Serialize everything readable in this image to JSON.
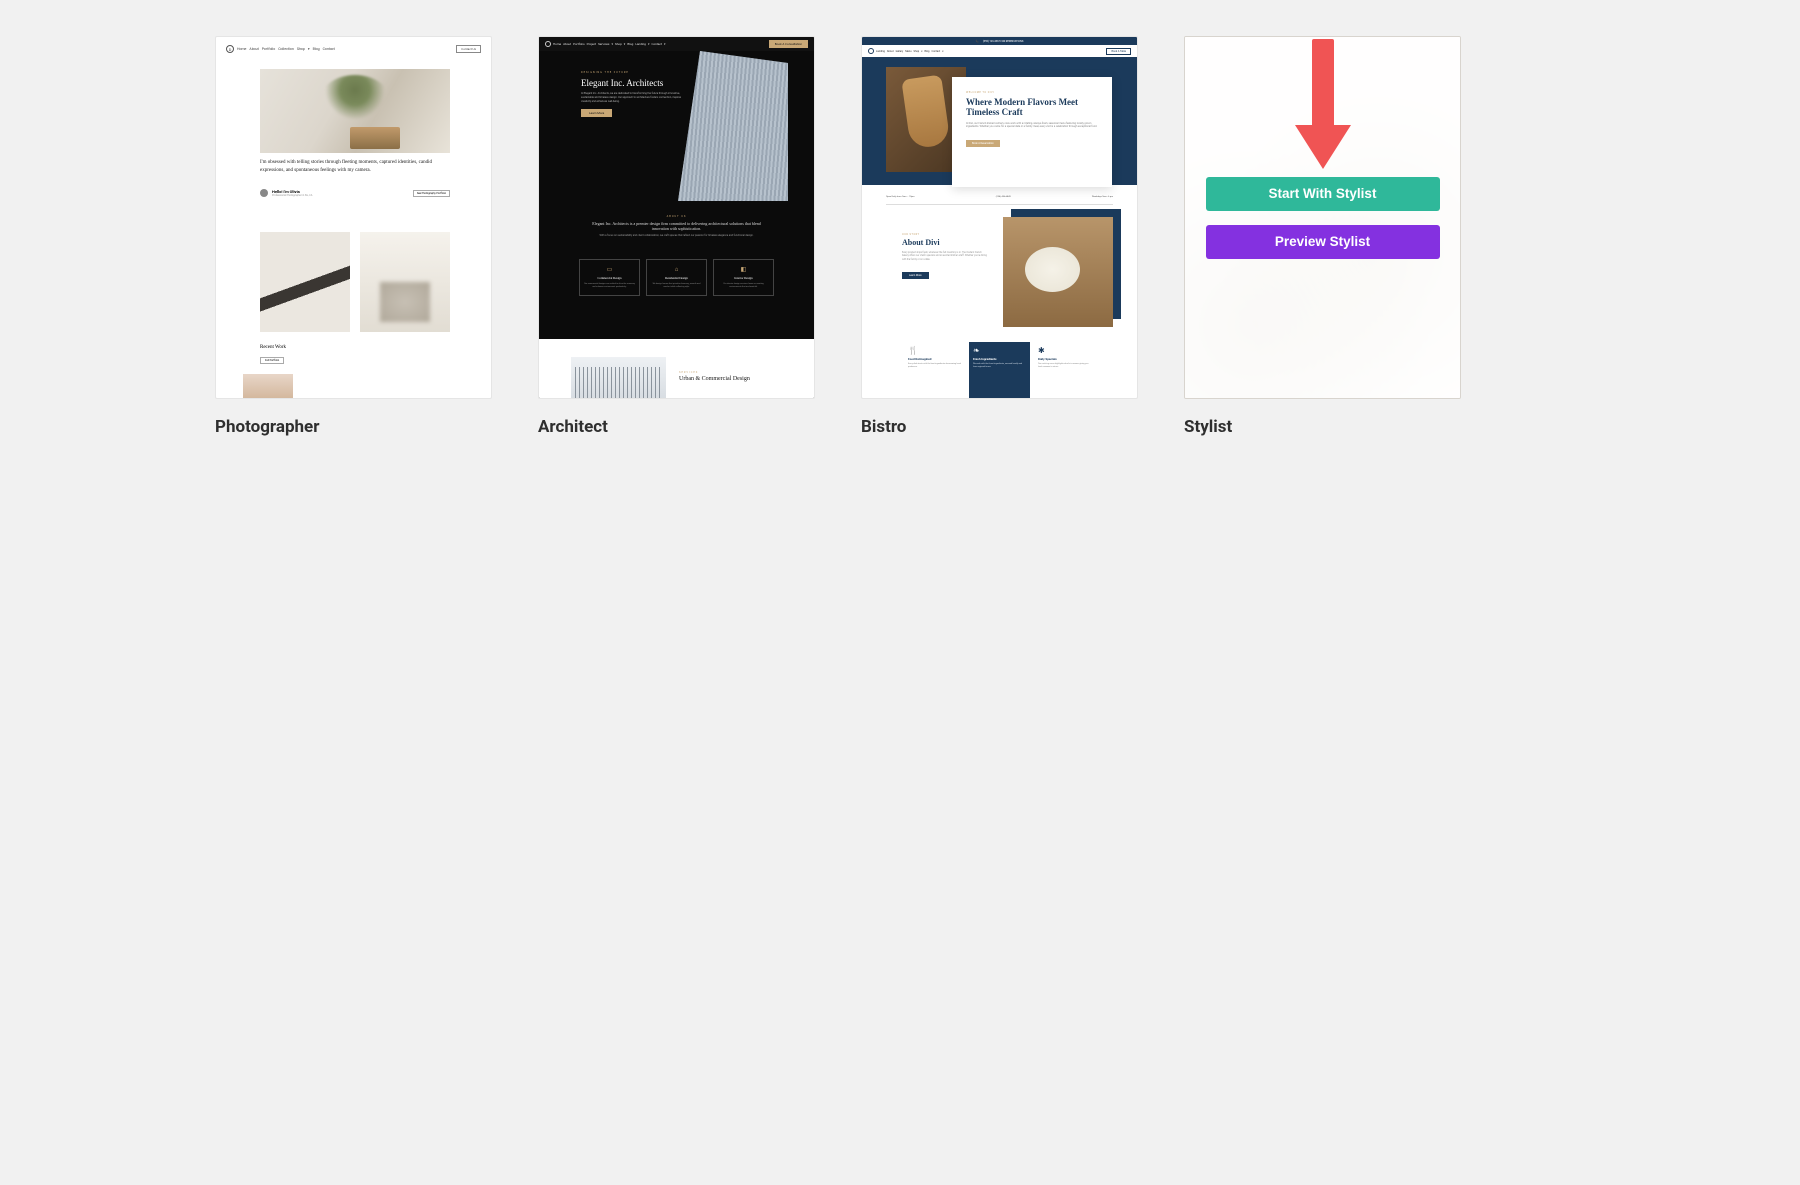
{
  "templates": [
    {
      "title": "Photographer",
      "nav": [
        "Home",
        "About",
        "Portfolio",
        "Collection",
        "Shop",
        "Blog",
        "Contact"
      ],
      "nav_btn": "Contact Us",
      "tagline": "I'm obsessed with telling stories through fleeting moments, captured identities, candid expressions, and spontaneous feelings with my camera.",
      "author": "Hello! I'm Olivia",
      "author_sub": "Professional Photographer in NL, CA",
      "portfolio_btn": "See Photography Portfolio",
      "recent": "Recent Work",
      "recent_btn": "Full Portfolio"
    },
    {
      "title": "Architect",
      "nav": [
        "Home",
        "About",
        "Portfolio",
        "Project",
        "Services",
        "Shop",
        "Blog",
        "Landing",
        "Contact"
      ],
      "nav_btn": "Book A Consultation",
      "kicker": "DESIGNING THE FUTURE",
      "headline": "Elegant Inc. Architects",
      "cta": "Learn More",
      "about_kicker": "ABOUT US",
      "about_title": "Elegant Inc. Architects is a premier design firm committed to delivering architectural solutions that blend innovation with sophistication.",
      "cards": [
        {
          "icon": "▭",
          "title": "Commercial Design"
        },
        {
          "icon": "⌂",
          "title": "Residential Design"
        },
        {
          "icon": "◧",
          "title": "Interior Design"
        }
      ],
      "section2_kicker": "SERVICES",
      "section2_title": "Urban & Commercial Design"
    },
    {
      "title": "Bistro",
      "topbar": "(555) 123-4567 FOR RESERVATIONS",
      "nav": [
        "Landing",
        "About",
        "Gallery",
        "Menu",
        "Shop",
        "Blog",
        "Contact"
      ],
      "nav_btn": "Book A Table",
      "hero_kicker": "WELCOME TO DIVI",
      "hero_title": "Where Modern Flavors Meet Timeless Craft",
      "hero_cta": "Book A Reservation",
      "info_left": "Open Daily from 9am – 10pm",
      "info_mid": "(234) 456-6849",
      "info_right": "Weekdays 9am–6 pm",
      "about_kicker": "OUR STORY",
      "about_title": "About Divi",
      "about_cta": "Learn More",
      "tiles": [
        {
          "icon": "🍴",
          "title": "Food Reimagined"
        },
        {
          "icon": "❧",
          "title": "Fresh Ingredients"
        },
        {
          "icon": "✱",
          "title": "Daily Specials"
        }
      ]
    },
    {
      "title": "Stylist",
      "start": "Start With Stylist",
      "preview": "Preview Stylist"
    }
  ]
}
